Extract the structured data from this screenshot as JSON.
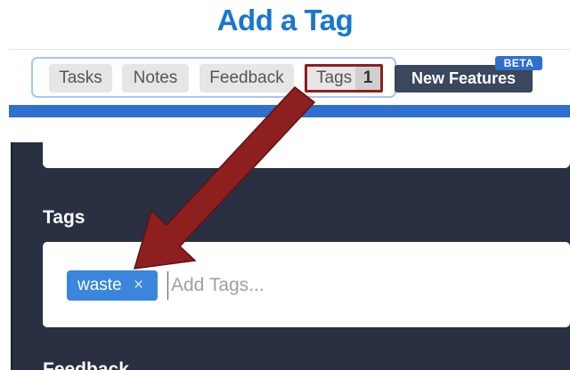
{
  "title": "Add a Tag",
  "nav": {
    "tabs": [
      {
        "label": "Tasks"
      },
      {
        "label": "Notes"
      },
      {
        "label": "Feedback"
      },
      {
        "label": "Tags",
        "count": "1"
      }
    ],
    "new_features_label": "New Features",
    "beta_badge": "BETA"
  },
  "tags_section": {
    "label": "Tags",
    "chips": [
      {
        "label": "waste",
        "remove_glyph": "×"
      }
    ],
    "input_placeholder": "Add Tags..."
  },
  "next_section": {
    "label": "Feedback"
  },
  "colors": {
    "title": "#1976d2",
    "accent_blue": "#2f6fcf",
    "chip": "#3b86dd",
    "panel": "#283042",
    "arrow": "#8e1f1f",
    "new_features_bg": "#3a475c"
  }
}
